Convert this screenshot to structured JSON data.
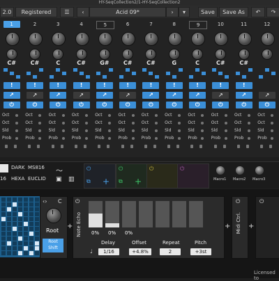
{
  "window": {
    "title": "HY-SeqCollection2/1-HY-SeqCollection2"
  },
  "toolbar": {
    "version": "2.0",
    "registered": "Registered",
    "preset": "Acid 09*",
    "save": "Save",
    "save_as": "Save As"
  },
  "steps": {
    "numbers": [
      "1",
      "2",
      "3",
      "4",
      "5",
      "6",
      "7",
      "8",
      "9",
      "10",
      "11",
      "12"
    ],
    "selected_index": 0,
    "notes": [
      "C#",
      "C#",
      "C",
      "C#",
      "G#",
      "C#",
      "C#",
      "G",
      "C",
      "C#",
      "C#"
    ],
    "accents": [
      "!",
      "!",
      "!",
      "!",
      "!",
      "!",
      "!",
      "!",
      "!",
      "!",
      "!"
    ],
    "row_labels": [
      "Oct",
      "Oct",
      "Sld",
      "Prob"
    ],
    "row_labels_extra": [
      "Oct",
      "Oct",
      "Sld",
      "Prob"
    ]
  },
  "mid": {
    "mode_a": "DARK",
    "mode_b": "MS816",
    "mode_c": "HEXA",
    "mode_d": "EUCLID",
    "num_16": "16",
    "macros": [
      "Macro1",
      "Macro2",
      "Macro3"
    ]
  },
  "bottom": {
    "root_label": "Root",
    "root_note": "C",
    "root_shift": "Root\nShift",
    "note_echo": "Note Echo",
    "midi_ctrl": "Midi Ctrl.",
    "bar_values": [
      "0%",
      "0%",
      "0%"
    ],
    "params": [
      {
        "label": "Delay",
        "value": "1/16"
      },
      {
        "label": "Offset",
        "value": "+4.8%"
      },
      {
        "label": "Repeat",
        "value": "2"
      },
      {
        "label": "Pitch",
        "value": "+3st"
      }
    ],
    "license": "Licensed to"
  },
  "colors": {
    "accent": "#3b8fd8",
    "grid_bg": "#1d5f8c"
  }
}
